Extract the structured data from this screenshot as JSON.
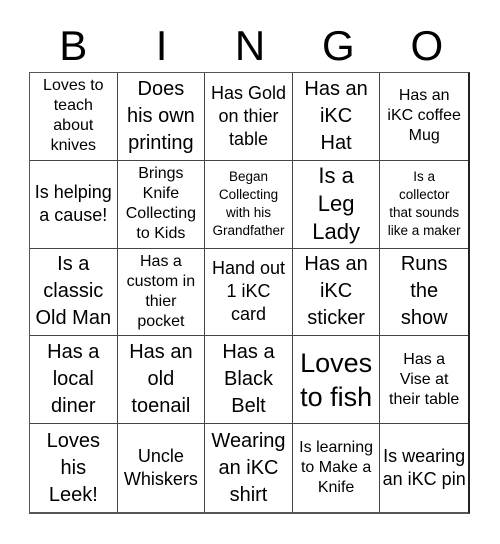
{
  "title_letters": [
    "B",
    "I",
    "N",
    "G",
    "O"
  ],
  "cells": [
    "Loves to\nteach\nabout\nknives",
    "Does\nhis own\nprinting",
    "Has Gold\non thier\ntable",
    "Has an\niKC\nHat",
    "Has an\niKC coffee\nMug",
    "Is helping\na cause!",
    "Brings\nKnife\nCollecting\nto Kids",
    "Began\nCollecting\nwith his\nGrandfather",
    "Is a\nLeg\nLady",
    "Is a\ncollector\nthat sounds\nlike a maker",
    "Is a\nclassic\nOld Man",
    "Has a\ncustom in\nthier\npocket",
    "Hand out\n1 iKC\ncard",
    "Has an\niKC\nsticker",
    "Runs\nthe\nshow",
    "Has a\nlocal\ndiner",
    "Has an\nold\ntoenail",
    "Has a\nBlack\nBelt",
    "Loves\nto fish",
    "Has a\nVise at\ntheir table",
    "Loves\nhis\nLeek!",
    "Uncle\nWhiskers",
    "Wearing\nan iKC\nshirt",
    "Is learning\nto Make a\nKnife",
    "Is wearing\nan iKC pin"
  ]
}
